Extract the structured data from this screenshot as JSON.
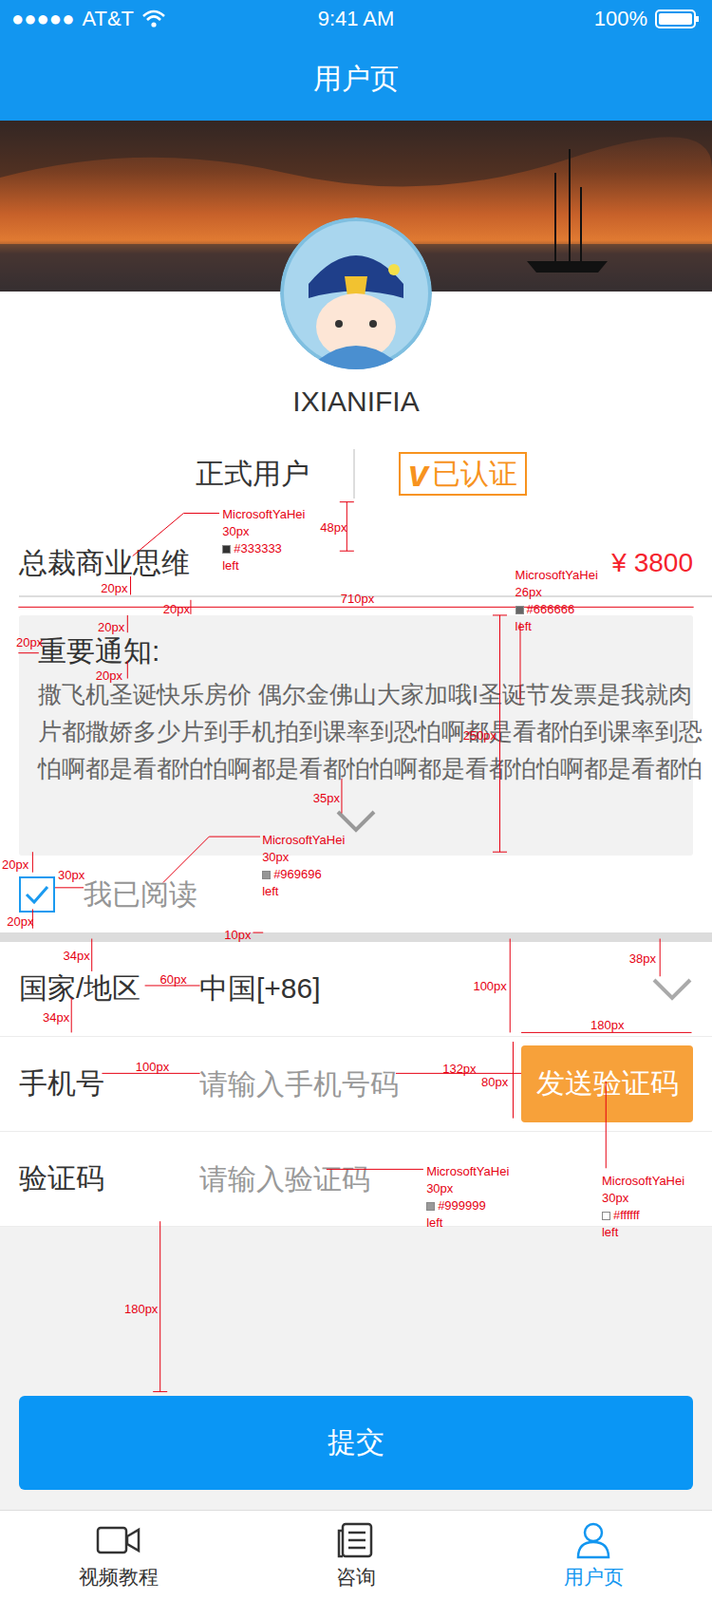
{
  "status_bar": {
    "signal": "●●●●●",
    "carrier": "AT&T",
    "time": "9:41 AM",
    "battery": "100%"
  },
  "nav": {
    "title": "用户页"
  },
  "profile": {
    "name": "IXIANIFIA",
    "user_type": "正式用户",
    "badge": {
      "icon": "v",
      "label": "已认证"
    }
  },
  "course": {
    "title": "总裁商业思维",
    "price": "¥ 3800"
  },
  "notice": {
    "title": "重要通知:",
    "lines": [
      "撒飞机圣诞快乐房价 偶尔金佛山大家加哦I圣诞节发票是我就肉",
      "片都撒娇多少片到手机拍到课率到恐怕啊都是看都怕到课率到恐",
      "怕啊都是看都怕怕啊都是看都怕怕啊都是看都怕怕啊都是看都怕"
    ],
    "expanded": false
  },
  "agreement": {
    "label": "我已阅读",
    "checked": true
  },
  "form": {
    "rows": [
      {
        "kind": "select",
        "label": "国家/地区",
        "value": "中国[+86]"
      },
      {
        "kind": "input-button",
        "label": "手机号",
        "placeholder": "请输入手机号码",
        "button": "发送验证码"
      },
      {
        "kind": "input",
        "label": "验证码",
        "placeholder": "请输入验证码"
      }
    ]
  },
  "submit": "提交",
  "tab_bar": [
    {
      "label": "视频教程",
      "selected": false
    },
    {
      "label": "咨询",
      "selected": false
    },
    {
      "label": "用户页",
      "selected": true
    }
  ],
  "annotations": {
    "specs": [
      {
        "lines": [
          "MicrosoftYaHei",
          "30px",
          "#333333",
          "left"
        ]
      },
      {
        "lines": [
          "MicrosoftYaHei",
          "26px",
          "#666666",
          "left"
        ]
      },
      {
        "lines": [
          "MicrosoftYaHei",
          "30px",
          "#969696",
          "left"
        ]
      },
      {
        "lines": [
          "MicrosoftYaHei",
          "30px",
          "#999999",
          "left"
        ]
      },
      {
        "lines": [
          "MicrosoftYaHei",
          "30px",
          "#ffffff",
          "left"
        ]
      }
    ],
    "dimensions": [
      "48px",
      "20px",
      "20px",
      "710px",
      "20px",
      "20px",
      "20px",
      "250px",
      "35px",
      "20px",
      "30px",
      "20px",
      "10px",
      "34px",
      "60px",
      "34px",
      "100px",
      "38px",
      "180px",
      "100px",
      "132px",
      "80px",
      "180px"
    ]
  }
}
